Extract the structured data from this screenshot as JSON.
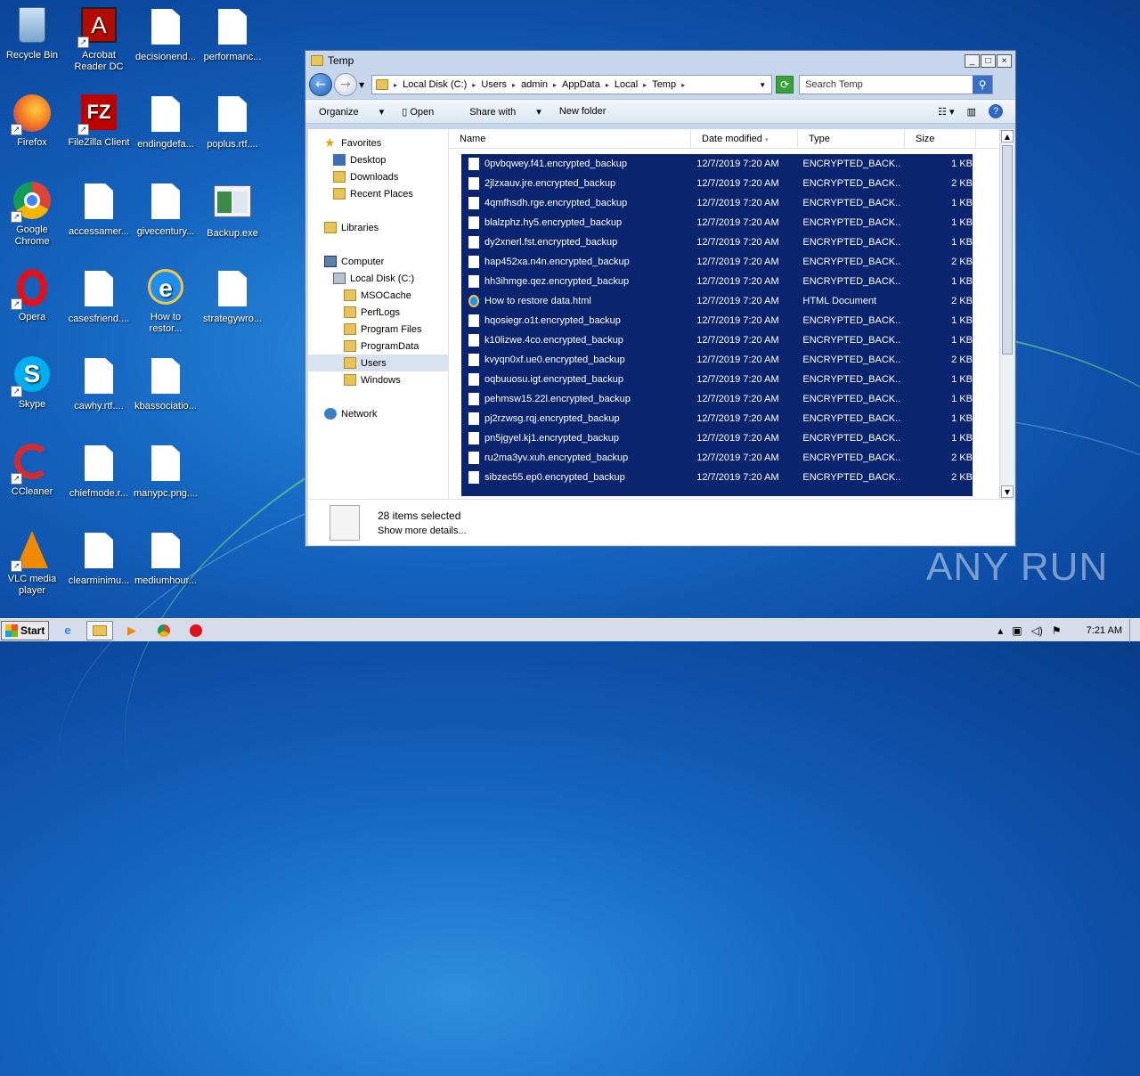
{
  "desktop_icons": [
    {
      "label": "Recycle Bin",
      "icon": "recycle-bin-icon"
    },
    {
      "label": "Acrobat Reader DC",
      "icon": "acrobat-icon"
    },
    {
      "label": "decisionend...",
      "icon": "file-icon"
    },
    {
      "label": "performanc...",
      "icon": "file-icon"
    },
    {
      "label": "Firefox",
      "icon": "firefox-icon"
    },
    {
      "label": "FileZilla Client",
      "icon": "filezilla-icon"
    },
    {
      "label": "endingdefa...",
      "icon": "file-icon"
    },
    {
      "label": "poplus.rtf....",
      "icon": "file-icon"
    },
    {
      "label": "Google Chrome",
      "icon": "chrome-icon"
    },
    {
      "label": "accessamer...",
      "icon": "file-icon"
    },
    {
      "label": "givecentury...",
      "icon": "file-icon"
    },
    {
      "label": "Backup.exe",
      "icon": "exe-icon"
    },
    {
      "label": "Opera",
      "icon": "opera-icon"
    },
    {
      "label": "casesfriend....",
      "icon": "file-icon"
    },
    {
      "label": "How to restor...",
      "icon": "ie-icon"
    },
    {
      "label": "strategywro...",
      "icon": "file-icon"
    },
    {
      "label": "Skype",
      "icon": "skype-icon"
    },
    {
      "label": "cawhy.rtf....",
      "icon": "file-icon"
    },
    {
      "label": "kbassociatio...",
      "icon": "file-icon"
    },
    {
      "label": "CCleaner",
      "icon": "ccleaner-icon"
    },
    {
      "label": "chiefmode.r...",
      "icon": "file-icon"
    },
    {
      "label": "manypc.png....",
      "icon": "file-icon"
    },
    {
      "label": "VLC media player",
      "icon": "vlc-icon"
    },
    {
      "label": "clearminimu...",
      "icon": "file-icon"
    },
    {
      "label": "mediumhour...",
      "icon": "file-icon"
    }
  ],
  "window": {
    "title": "Temp",
    "controls": {
      "minimize": "_",
      "maximize": "□",
      "close": "×"
    },
    "breadcrumbs": [
      "Local Disk (C:)",
      "Users",
      "admin",
      "AppData",
      "Local",
      "Temp"
    ],
    "search_placeholder": "Search Temp",
    "toolbar": {
      "organize": "Organize",
      "open": "Open",
      "share_with": "Share with",
      "new_folder": "New folder"
    },
    "nav": {
      "favorites": "Favorites",
      "desktop": "Desktop",
      "downloads": "Downloads",
      "recent_places": "Recent Places",
      "libraries": "Libraries",
      "computer": "Computer",
      "local_disk": "Local Disk (C:)",
      "folders": [
        "MSOCache",
        "PerfLogs",
        "Program Files",
        "ProgramData",
        "Users",
        "Windows"
      ],
      "network": "Network"
    },
    "columns": {
      "name": "Name",
      "date": "Date modified",
      "type": "Type",
      "size": "Size"
    },
    "files": [
      {
        "name": "0pvbqwey.f41.encrypted_backup",
        "date": "12/7/2019 7:20 AM",
        "type": "ENCRYPTED_BACK...",
        "size": "1 KB"
      },
      {
        "name": "2jlzxauv.jre.encrypted_backup",
        "date": "12/7/2019 7:20 AM",
        "type": "ENCRYPTED_BACK...",
        "size": "2 KB"
      },
      {
        "name": "4qmfhsdh.rge.encrypted_backup",
        "date": "12/7/2019 7:20 AM",
        "type": "ENCRYPTED_BACK...",
        "size": "1 KB"
      },
      {
        "name": "blalzphz.hy5.encrypted_backup",
        "date": "12/7/2019 7:20 AM",
        "type": "ENCRYPTED_BACK...",
        "size": "1 KB"
      },
      {
        "name": "dy2xnerl.fst.encrypted_backup",
        "date": "12/7/2019 7:20 AM",
        "type": "ENCRYPTED_BACK...",
        "size": "1 KB"
      },
      {
        "name": "hap452xa.n4n.encrypted_backup",
        "date": "12/7/2019 7:20 AM",
        "type": "ENCRYPTED_BACK...",
        "size": "2 KB"
      },
      {
        "name": "hh3ihmge.qez.encrypted_backup",
        "date": "12/7/2019 7:20 AM",
        "type": "ENCRYPTED_BACK...",
        "size": "1 KB"
      },
      {
        "name": "How to restore data.html",
        "date": "12/7/2019 7:20 AM",
        "type": "HTML Document",
        "size": "2 KB"
      },
      {
        "name": "hqosiegr.o1t.encrypted_backup",
        "date": "12/7/2019 7:20 AM",
        "type": "ENCRYPTED_BACK...",
        "size": "1 KB"
      },
      {
        "name": "k10lizwe.4co.encrypted_backup",
        "date": "12/7/2019 7:20 AM",
        "type": "ENCRYPTED_BACK...",
        "size": "1 KB"
      },
      {
        "name": "kvyqn0xf.ue0.encrypted_backup",
        "date": "12/7/2019 7:20 AM",
        "type": "ENCRYPTED_BACK...",
        "size": "2 KB"
      },
      {
        "name": "oqbuuosu.igt.encrypted_backup",
        "date": "12/7/2019 7:20 AM",
        "type": "ENCRYPTED_BACK...",
        "size": "1 KB"
      },
      {
        "name": "pehmsw15.22l.encrypted_backup",
        "date": "12/7/2019 7:20 AM",
        "type": "ENCRYPTED_BACK...",
        "size": "1 KB"
      },
      {
        "name": "pj2rzwsg.rqj.encrypted_backup",
        "date": "12/7/2019 7:20 AM",
        "type": "ENCRYPTED_BACK...",
        "size": "1 KB"
      },
      {
        "name": "pn5jgyel.kj1.encrypted_backup",
        "date": "12/7/2019 7:20 AM",
        "type": "ENCRYPTED_BACK...",
        "size": "1 KB"
      },
      {
        "name": "ru2ma3yv.xuh.encrypted_backup",
        "date": "12/7/2019 7:20 AM",
        "type": "ENCRYPTED_BACK...",
        "size": "2 KB"
      },
      {
        "name": "sibzec55.ep0.encrypted_backup",
        "date": "12/7/2019 7:20 AM",
        "type": "ENCRYPTED_BACK...",
        "size": "2 KB"
      }
    ],
    "details": {
      "count": "28 items selected",
      "more": "Show more details..."
    }
  },
  "taskbar": {
    "start": "Start",
    "clock": "7:21 AM"
  },
  "watermark": "ANY RUN",
  "colors": {
    "selection": "#0a2470",
    "desktop": "#1565c0"
  }
}
